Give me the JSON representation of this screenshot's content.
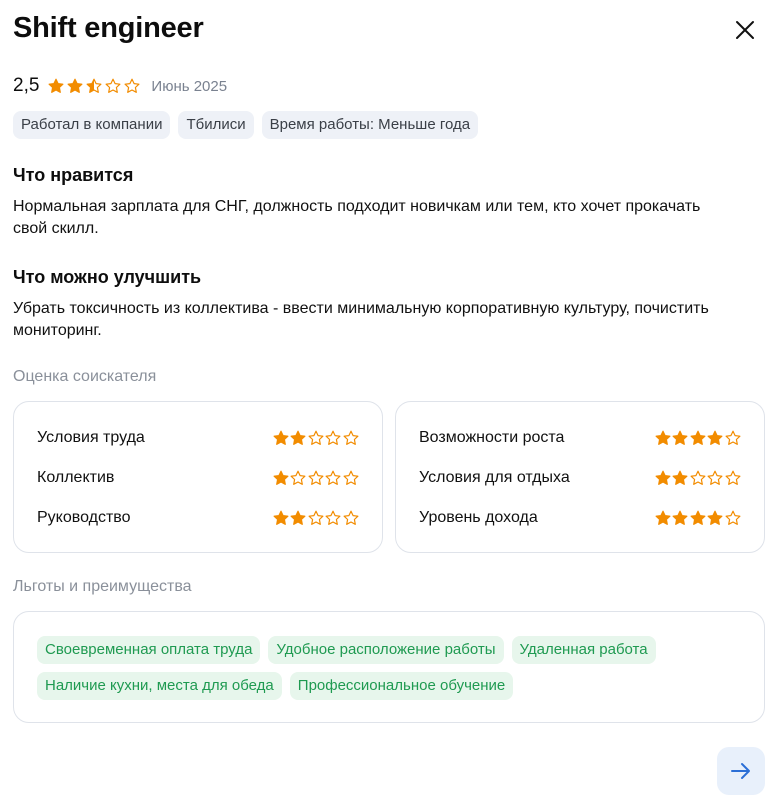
{
  "header": {
    "title": "Shift engineer"
  },
  "rating": {
    "value": "2,5",
    "stars": 2.5,
    "date": "Июнь 2025",
    "star_color": "#f28c00"
  },
  "tags": [
    "Работал в компании",
    "Тбилиси",
    "Время работы: Меньше года"
  ],
  "likes": {
    "heading": "Что нравится",
    "text": "Нормальная зарплата для СНГ, должность подходит новичкам или тем, кто хочет прокачать свой скилл."
  },
  "improve": {
    "heading": "Что можно улучшить",
    "text": "Убрать токсичность из коллектива - ввести минимальную корпоративную культуру, почистить мониторинг."
  },
  "assessment": {
    "heading": "Оценка соискателя",
    "left": [
      {
        "label": "Условия труда",
        "stars": 2
      },
      {
        "label": "Коллектив",
        "stars": 1
      },
      {
        "label": "Руководство",
        "stars": 2
      }
    ],
    "right": [
      {
        "label": "Возможности роста",
        "stars": 4
      },
      {
        "label": "Условия для отдыха",
        "stars": 2
      },
      {
        "label": "Уровень дохода",
        "stars": 4
      }
    ]
  },
  "benefits": {
    "heading": "Льготы и преимущества",
    "row1": [
      "Своевременная оплата труда",
      "Удобное расположение работы",
      "Удаленная работа"
    ],
    "row2": [
      "Наличие кухни, места для обеда",
      "Профессиональное обучение"
    ]
  },
  "icons": {
    "close": "close-icon",
    "next": "arrow-right-icon",
    "accent": "#2b6fd6"
  }
}
